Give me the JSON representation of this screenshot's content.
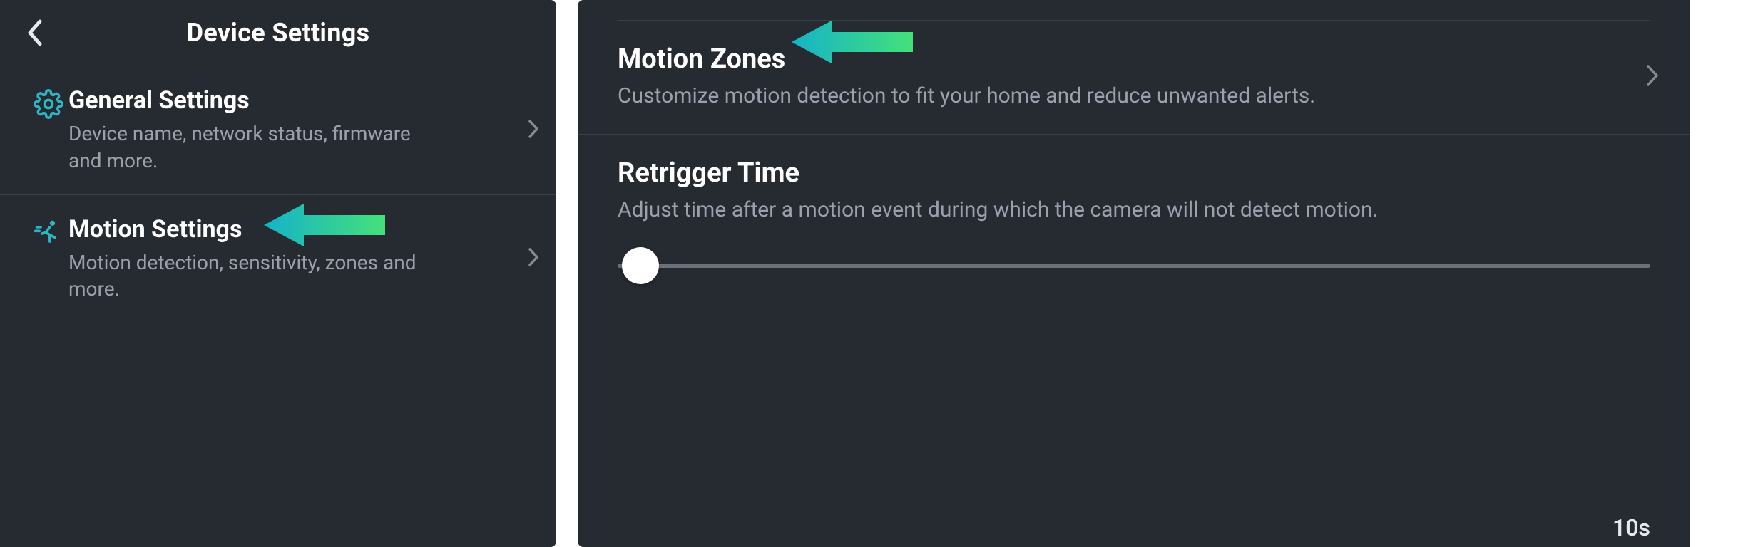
{
  "left": {
    "header_title": "Device Settings",
    "items": [
      {
        "title": "General Settings",
        "subtitle": "Device name, network status, firmware and more."
      },
      {
        "title": "Motion Settings",
        "subtitle": "Motion detection, sensitivity, zones and more."
      }
    ]
  },
  "right": {
    "motion_zones": {
      "title": "Motion Zones",
      "subtitle": "Customize motion detection to fit your home and reduce unwanted alerts."
    },
    "retrigger": {
      "title": "Retrigger Time",
      "subtitle": "Adjust time after a motion event during which the camera will not detect motion.",
      "value_label": "10s"
    }
  },
  "colors": {
    "accent": "#2fb4c2",
    "arrow_start": "#14b3c8",
    "arrow_end": "#45e07a"
  }
}
